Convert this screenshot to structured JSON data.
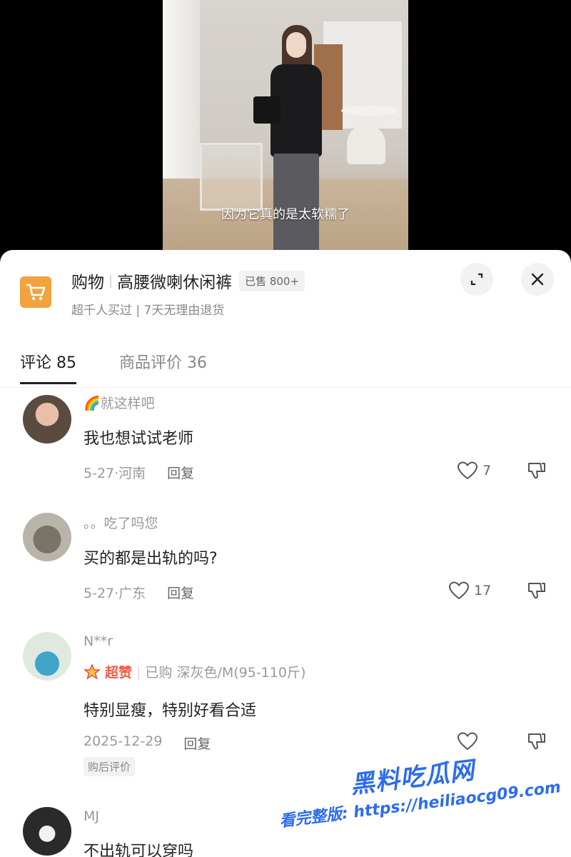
{
  "video": {
    "subtitle": "因为它真的是太软糯了"
  },
  "product": {
    "icon": "shopping-cart-icon",
    "category": "购物",
    "name": "高腰微喇休闲裤",
    "sold_badge": "已售 800+",
    "subtitle": "超千人买过 | 7天无理由退货"
  },
  "tabs": [
    {
      "label": "评论 85",
      "active": true
    },
    {
      "label": "商品评价 36",
      "active": false
    }
  ],
  "comments": [
    {
      "username": "🌈就这样吧",
      "text": "我也想试试老师",
      "date_location": "5-27·河南",
      "reply": "回复",
      "likes": "7"
    },
    {
      "username": "。。吃了吗您",
      "text": "买的都是出轨的吗?",
      "date_location": "5-27·广东",
      "reply": "回复",
      "likes": "17"
    },
    {
      "username": "N**r",
      "badge": "超赞",
      "purchase_info": "已购 深灰色/M(95-110斤)",
      "text": "特别显瘦，特别好看合适",
      "date_location": "2025-12-29",
      "reply": "回复",
      "likes": "",
      "tag": "购后评价"
    },
    {
      "username": "MJ",
      "text": "不出轨可以穿吗"
    }
  ],
  "watermark": {
    "title": "黑料吃瓜网",
    "url": "看完整版: https://heiliaocg09.com"
  },
  "colors": {
    "accent": "#f2a33d",
    "superlike": "#f25b4b",
    "watermark": "#2d6cf0"
  }
}
